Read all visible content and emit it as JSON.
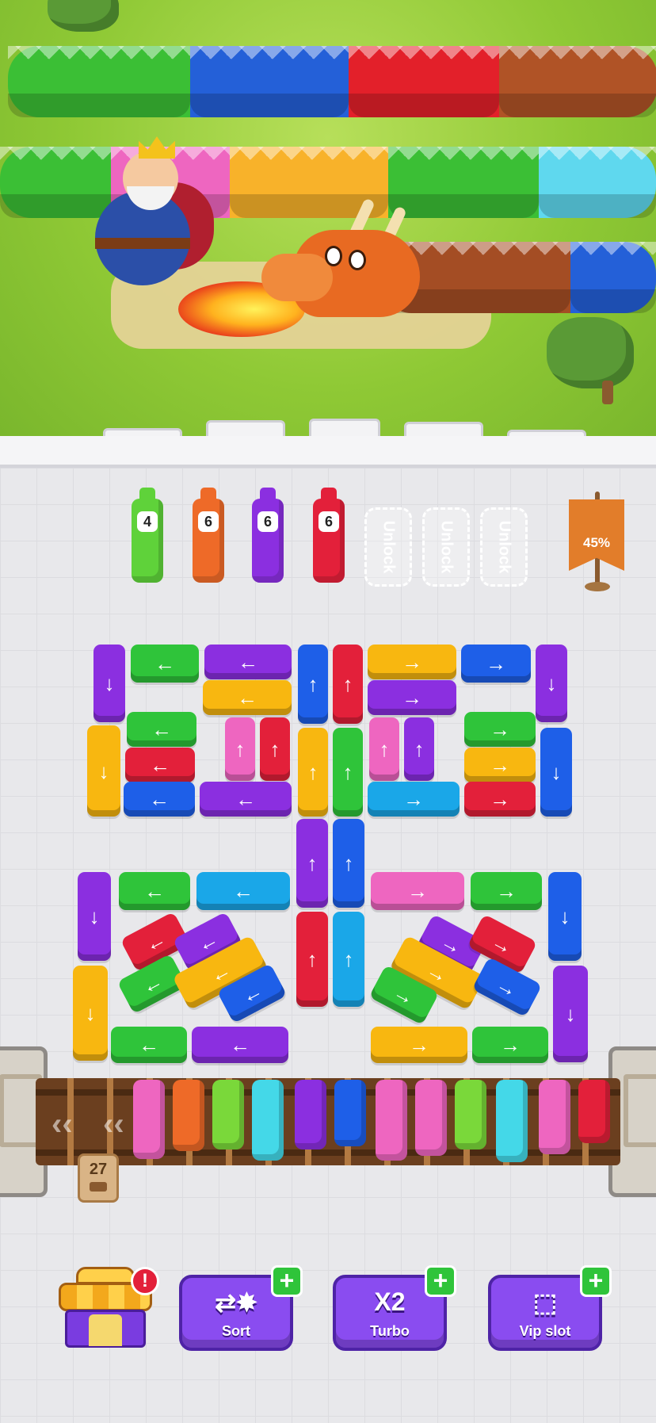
{
  "bottles": [
    {
      "count": "4",
      "color": "#5fd23a"
    },
    {
      "count": "6",
      "color": "#ee6a28"
    },
    {
      "count": "6",
      "color": "#8b2fe0"
    },
    {
      "count": "6",
      "color": "#e3203a"
    }
  ],
  "locked_slots": [
    {
      "label": "Unlock"
    },
    {
      "label": "Unlock"
    },
    {
      "label": "Unlock"
    }
  ],
  "progress": {
    "label": "45%",
    "value": 45
  },
  "conveyor": {
    "counter": "27"
  },
  "shop": {
    "alert": "!"
  },
  "tools": [
    {
      "label": "Sort",
      "icon": "⇄✸",
      "plus": "+"
    },
    {
      "label": "Turbo",
      "icon": "X2",
      "plus": "+"
    },
    {
      "label": "Vip slot",
      "icon": "⬚",
      "plus": "+"
    }
  ],
  "colors": {
    "purple": "#8b2fe0",
    "green": "#2fc43a",
    "blue": "#1e5fe8",
    "red": "#e3203a",
    "yellow": "#f8b710",
    "orange": "#ee6a28",
    "pink": "#ee66c0",
    "cyan": "#1aa7e8",
    "teal": "#44d8e8"
  },
  "icons": {
    "arrow_left": "←",
    "arrow_right": "→",
    "arrow_up": "↑",
    "arrow_down": "↓"
  }
}
